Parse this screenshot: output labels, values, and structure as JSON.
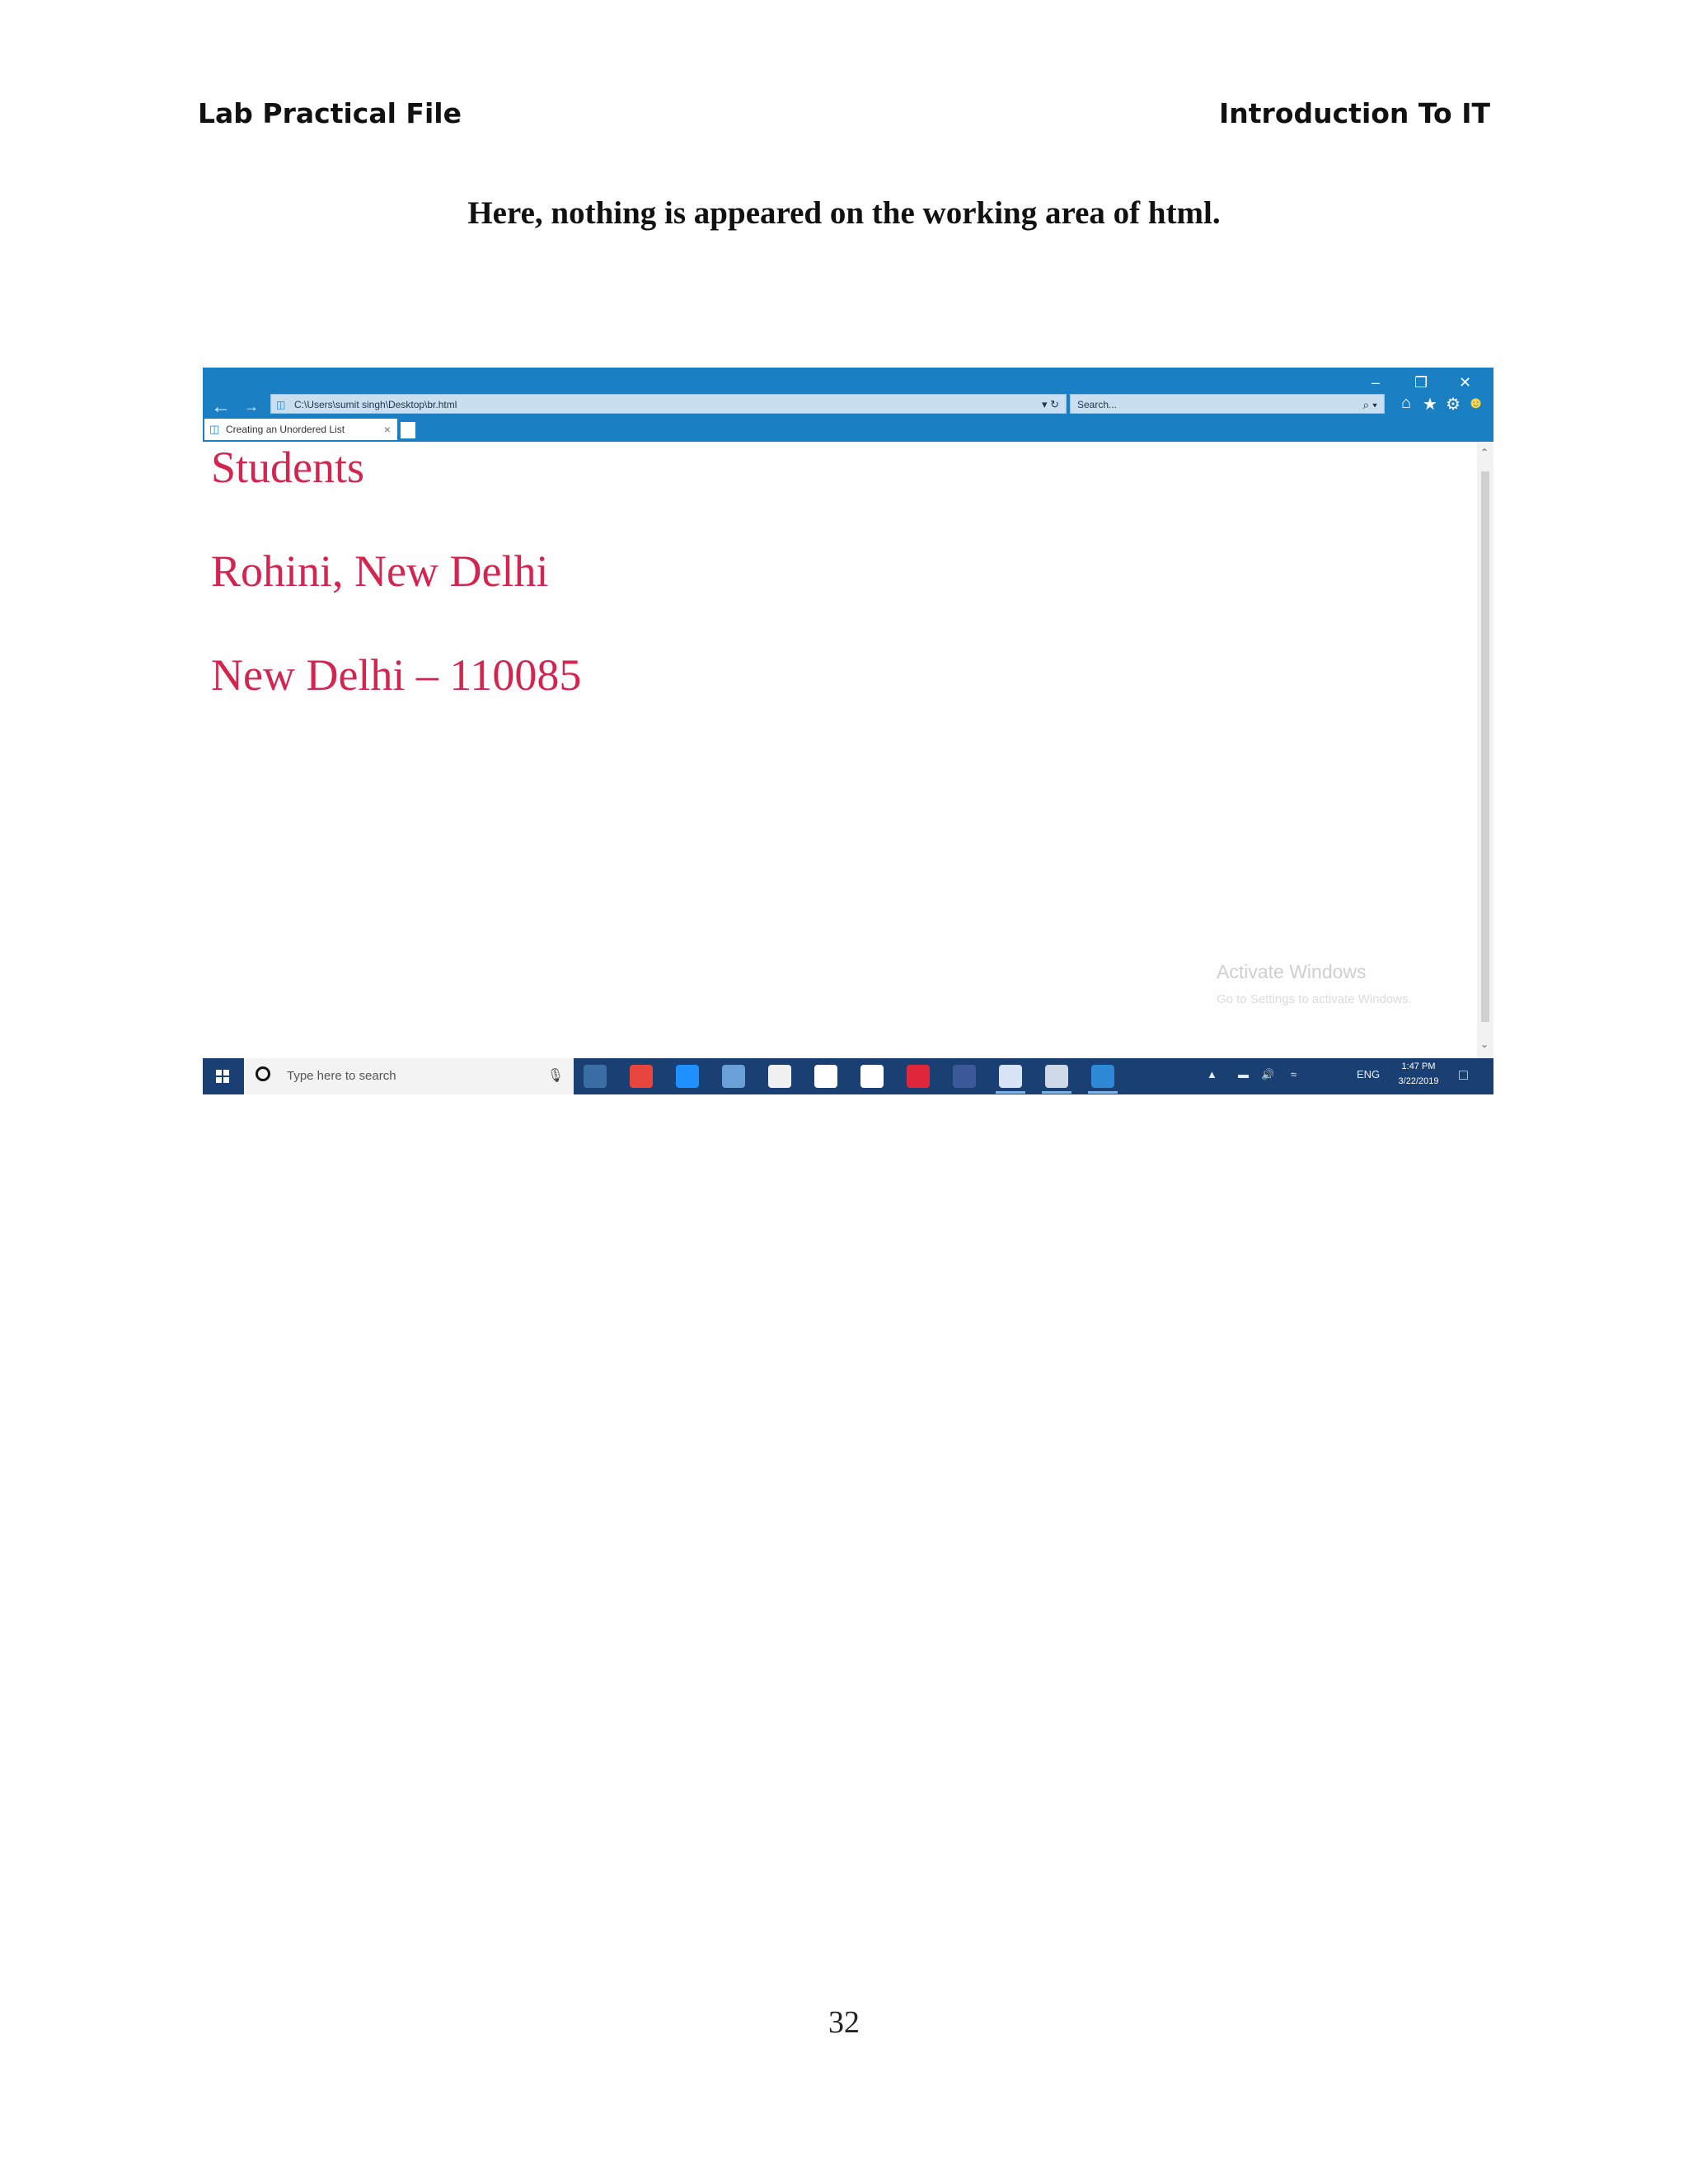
{
  "header": {
    "left": "Lab Practical File",
    "right": "Introduction To IT"
  },
  "caption": "Here, nothing is appeared on the working area of html.",
  "page_number": "32",
  "browser": {
    "window_controls": {
      "minimize": "–",
      "restore": "❐",
      "close": "✕"
    },
    "address": "C:\\Users\\sumit singh\\Desktop\\br.html",
    "address_controls": "▾ ↻",
    "search_placeholder": "Search...",
    "search_controls": "⌕ ▾",
    "tab_title": "Creating an Unordered List",
    "tab_close": "×",
    "content_lines": [
      "Students",
      "Rohini, New Delhi",
      "New Delhi – 110085"
    ],
    "watermark_title": "Activate Windows",
    "watermark_sub": "Go to Settings to activate Windows."
  },
  "taskbar": {
    "search_placeholder": "Type here to search",
    "language": "ENG",
    "time": "1:47 PM",
    "date": "3/22/2019",
    "app_colors": [
      "#3a6ea5",
      "#e8453c",
      "#1e90ff",
      "#6aa0d8",
      "#f0f0f0",
      "#ffffff",
      "#ffffff",
      "#e0263a",
      "#3b5998",
      "#d8e4f5",
      "#cfd8e6",
      "#2e89d6"
    ]
  },
  "colors": {
    "content_text": "#d2254f",
    "ie_chrome": "#1b7fc4",
    "taskbar": "#1a3f73"
  }
}
